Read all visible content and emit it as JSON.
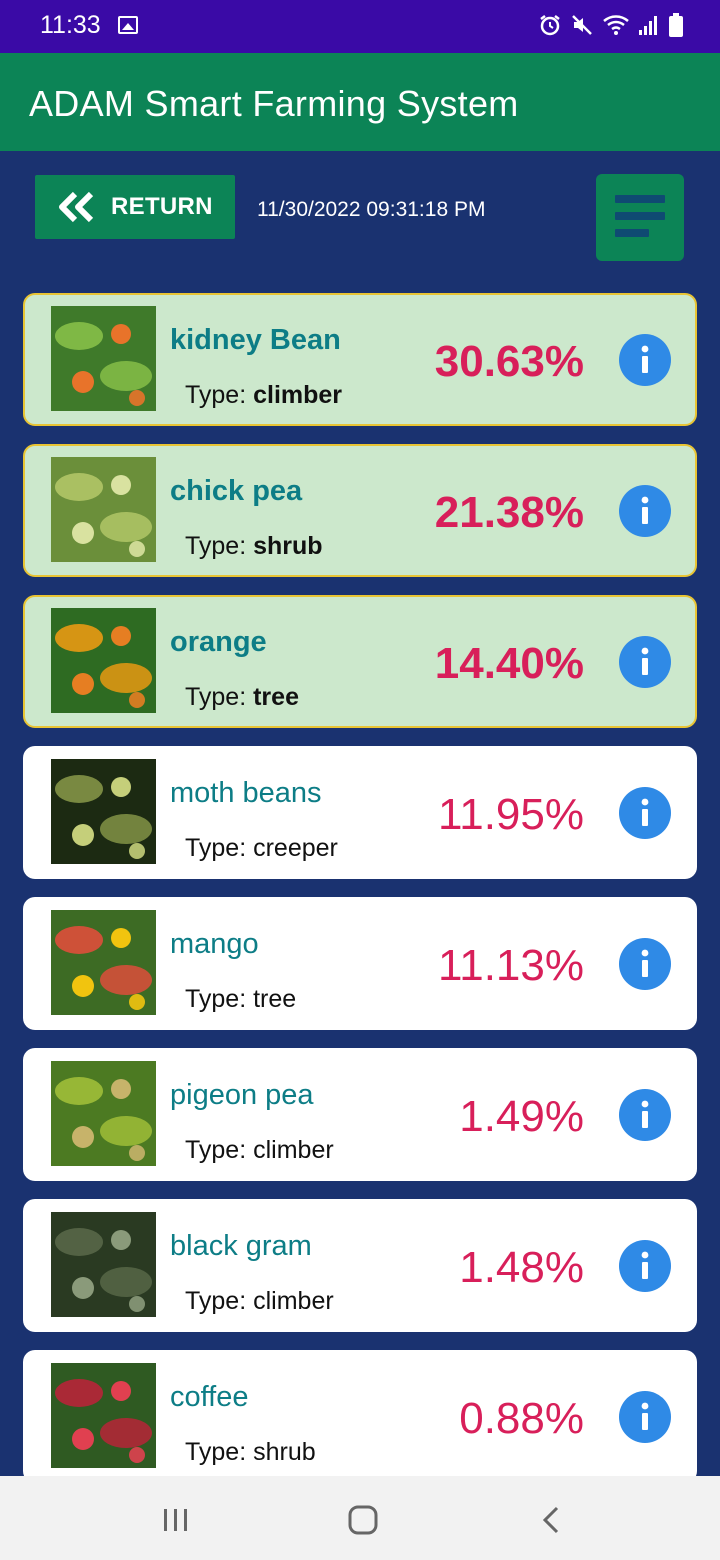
{
  "status_bar": {
    "time": "11:33"
  },
  "app_bar": {
    "title": "ADAM Smart Farming System"
  },
  "toolbar": {
    "return_label": "RETURN",
    "datetime": "11/30/2022 09:31:18 PM"
  },
  "type_prefix": "Type:",
  "crops": [
    {
      "name": "kidney Bean",
      "type": "climber",
      "percent": "30.63%",
      "highlighted": true
    },
    {
      "name": "chick pea",
      "type": "shrub",
      "percent": "21.38%",
      "highlighted": true
    },
    {
      "name": "orange",
      "type": "tree",
      "percent": "14.40%",
      "highlighted": true
    },
    {
      "name": "moth beans",
      "type": "creeper",
      "percent": "11.95%",
      "highlighted": false
    },
    {
      "name": "mango",
      "type": "tree",
      "percent": "11.13%",
      "highlighted": false
    },
    {
      "name": "pigeon pea",
      "type": "climber",
      "percent": "1.49%",
      "highlighted": false
    },
    {
      "name": "black gram",
      "type": "climber",
      "percent": "1.48%",
      "highlighted": false
    },
    {
      "name": "coffee",
      "type": "shrub",
      "percent": "0.88%",
      "highlighted": false
    }
  ],
  "colors": {
    "status_bar": "#3a0aa6",
    "app_bar": "#0c8456",
    "background": "#1a3270",
    "highlight_card": "#cce8cc",
    "highlight_border": "#e8c434",
    "crop_name": "#0d7d86",
    "percent": "#d81f5a",
    "info_button": "#2f8ae6"
  },
  "icons": [
    "gallery-icon",
    "alarm-icon",
    "mute-icon",
    "wifi-icon",
    "signal-icon",
    "battery-icon",
    "double-chevron-left-icon",
    "menu-icon",
    "info-icon",
    "recents-icon",
    "home-icon",
    "back-icon"
  ]
}
